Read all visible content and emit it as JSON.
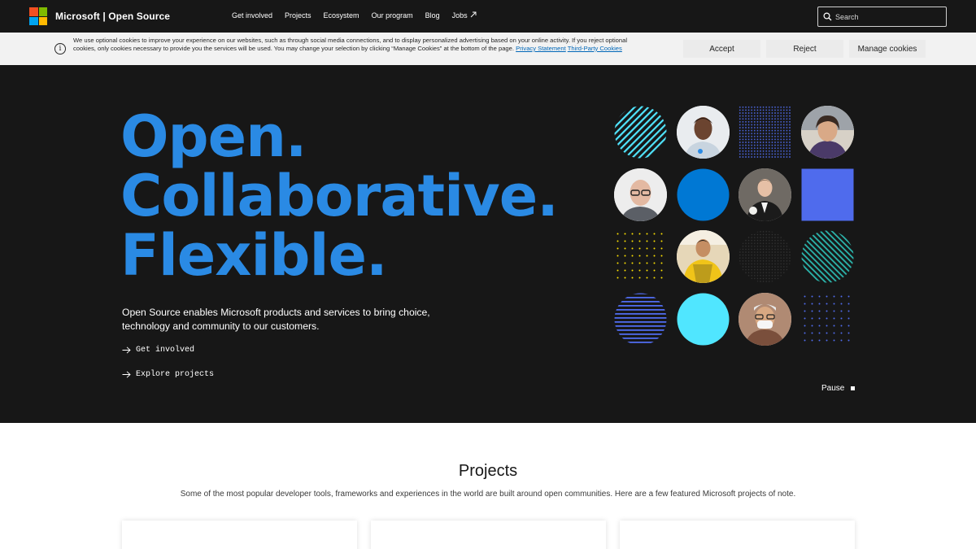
{
  "header": {
    "brand": "Microsoft | Open Source",
    "nav": [
      "Get involved",
      "Projects",
      "Ecosystem",
      "Our program",
      "Blog",
      "Jobs"
    ],
    "search_placeholder": "Search",
    "logo_colors": [
      "#f25022",
      "#7fba00",
      "#00a4ef",
      "#ffb900"
    ]
  },
  "cookies": {
    "text": "We use optional cookies to improve your experience on our websites, such as through social media connections, and to display personalized advertising based on your online activity. If you reject optional cookies, only cookies necessary to provide you the services will be used. You may change your selection by clicking “Manage Cookies” at the bottom of the page.",
    "privacy_link": "Privacy Statement",
    "third_party_link": "Third-Party Cookies",
    "accept": "Accept",
    "reject": "Reject",
    "manage": "Manage cookies"
  },
  "hero": {
    "title_lines": [
      "Open.",
      "Collaborative.",
      "Flexible."
    ],
    "description": "Open Source enables Microsoft products and services to bring choice, technology and community to our customers.",
    "link_get_involved": "Get involved",
    "link_explore": "Explore projects",
    "pause": "Pause",
    "accent_color": "#2a8ae4"
  },
  "projects": {
    "title": "Projects",
    "description": "Some of the most popular developer tools, frameworks and experiences in the world are built around open communities. Here are a few featured Microsoft projects of note."
  }
}
